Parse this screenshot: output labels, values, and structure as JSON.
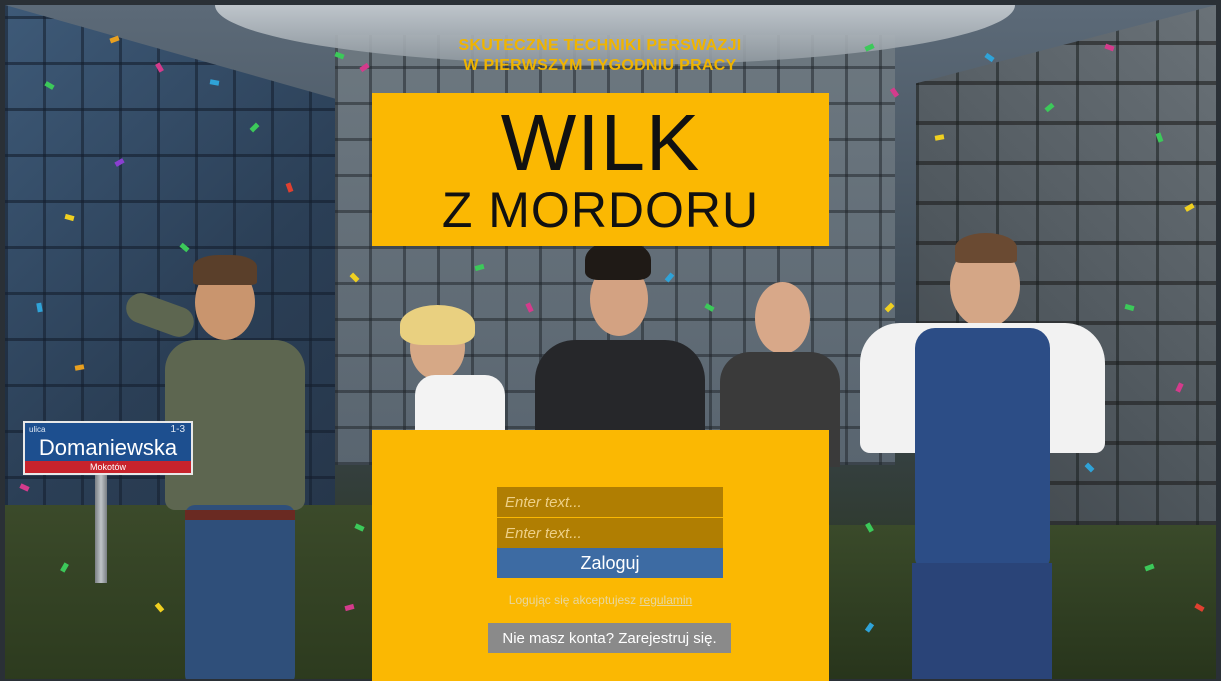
{
  "header": {
    "subtitle_line1": "SKUTECZNE TECHNIKI PERSWAZJI",
    "subtitle_line2": "W PIERWSZYM TYGODNIU PRACY",
    "logo_line1": "WILK",
    "logo_line2": "Z MORDORU"
  },
  "login": {
    "username_placeholder": "Enter text...",
    "password_placeholder": "Enter text...",
    "login_label": "Zaloguj",
    "terms_text": "Logując się akceptujesz",
    "terms_link": "regulamin",
    "register_label": "Nie masz konta? Zarejestruj się."
  },
  "street_sign": {
    "prefix": "ulica",
    "number": "1-3",
    "name": "Domaniewska",
    "district": "Mokotów"
  },
  "colors": {
    "accent": "#fbb802",
    "field": "#b07e02",
    "login_button": "#3d6ba3",
    "register_button": "#8a8a8a"
  }
}
